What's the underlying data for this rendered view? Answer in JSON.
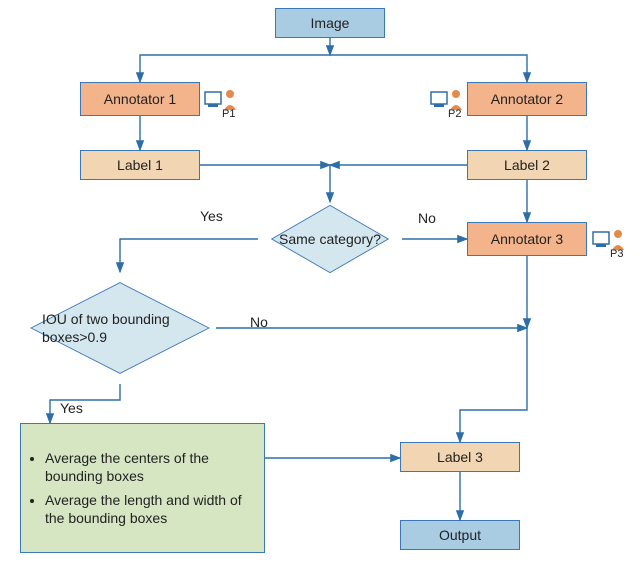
{
  "nodes": {
    "image": "Image",
    "annotator1": "Annotator 1",
    "annotator2": "Annotator 2",
    "annotator3": "Annotator 3",
    "label1": "Label 1",
    "label2": "Label 2",
    "label3": "Label 3",
    "sameCategory": "Same category?",
    "iouCheck": "IOU of two bounding boxes>0.9",
    "averaging": {
      "item1": "Average the centers of the bounding boxes",
      "item2": "Average the length and width of the bounding boxes"
    },
    "output": "Output"
  },
  "edgeLabels": {
    "yes1": "Yes",
    "no1": "No",
    "yes2": "Yes",
    "no2": "No"
  },
  "personLabels": {
    "p1": "P1",
    "p2": "P2",
    "p3": "P3"
  },
  "colors": {
    "blue": "#a9cce3",
    "orange": "#f3b48c",
    "tan": "#f2d6b3",
    "green": "#d6e5c2",
    "diamond": "#d4e6ee",
    "border": "#3a78b8",
    "arrow": "#2e6ea8",
    "personBlue": "#2e6ea8",
    "personOrange": "#e38b4a"
  }
}
